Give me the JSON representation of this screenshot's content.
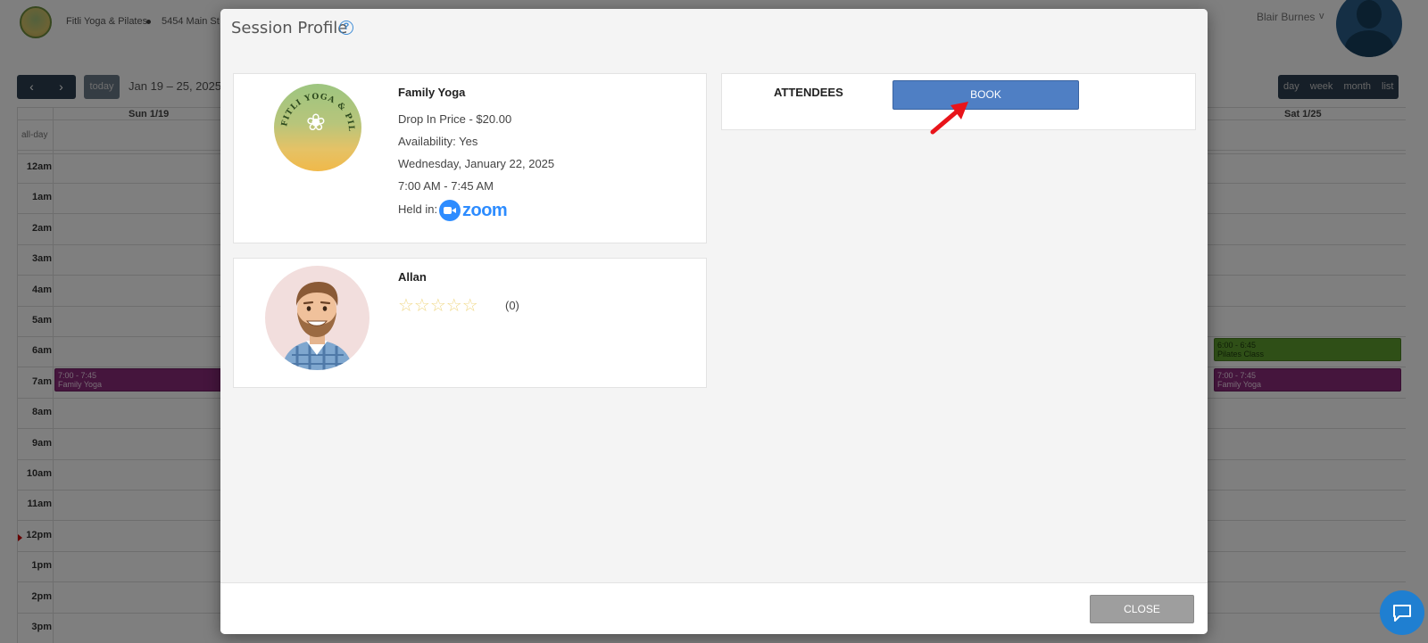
{
  "header": {
    "studio_name": "Fitli Yoga & Pilates",
    "studio_address": "5454 Main St",
    "user_name": "Blair Burnes",
    "user_caret": "v"
  },
  "calendar": {
    "prev_icon": "chevron-left-icon",
    "next_icon": "chevron-right-icon",
    "today_label": "today",
    "range_label": "Jan 19 – 25, 2025",
    "views": [
      "day",
      "week",
      "month",
      "list"
    ],
    "day_headers": [
      "Sun 1/19",
      "Sat 1/25"
    ],
    "allday_label": "all-day",
    "hours": [
      "12am",
      "1am",
      "2am",
      "3am",
      "4am",
      "5am",
      "6am",
      "7am",
      "8am",
      "9am",
      "10am",
      "11am",
      "12pm",
      "1pm",
      "2pm",
      "3pm"
    ],
    "events": [
      {
        "time": "7:00 - 7:45",
        "title": "Family Yoga"
      },
      {
        "time": "6:00 - 6:45",
        "title": "Pilates Class"
      },
      {
        "time": "7:00 - 7:45",
        "title": "Family Yoga"
      }
    ]
  },
  "modal": {
    "title": "Session Profile",
    "help_icon": "?",
    "session": {
      "logo_text": "FITLI YOGA & PILATES",
      "title": "Family Yoga",
      "price": "Drop In Price - $20.00",
      "availability": "Availability: Yes",
      "date": "Wednesday, January 22, 2025",
      "time": "7:00 AM - 7:45 AM",
      "held_in_label": "Held in:",
      "venue": "zoom"
    },
    "instructor": {
      "name": "Allan",
      "stars": "☆☆☆☆☆",
      "rating_count": "(0)"
    },
    "attendees": {
      "label": "ATTENDEES",
      "book_label": "BOOK"
    },
    "footer": {
      "close_label": "CLOSE"
    }
  },
  "colors": {
    "book_button": "#4f7fc4",
    "close_button": "#9e9e9e",
    "event_purple": "#8a2a7a",
    "event_green": "#5f9f2e",
    "zoom_blue": "#2d8cff",
    "chat_blue": "#1f7fd1"
  }
}
